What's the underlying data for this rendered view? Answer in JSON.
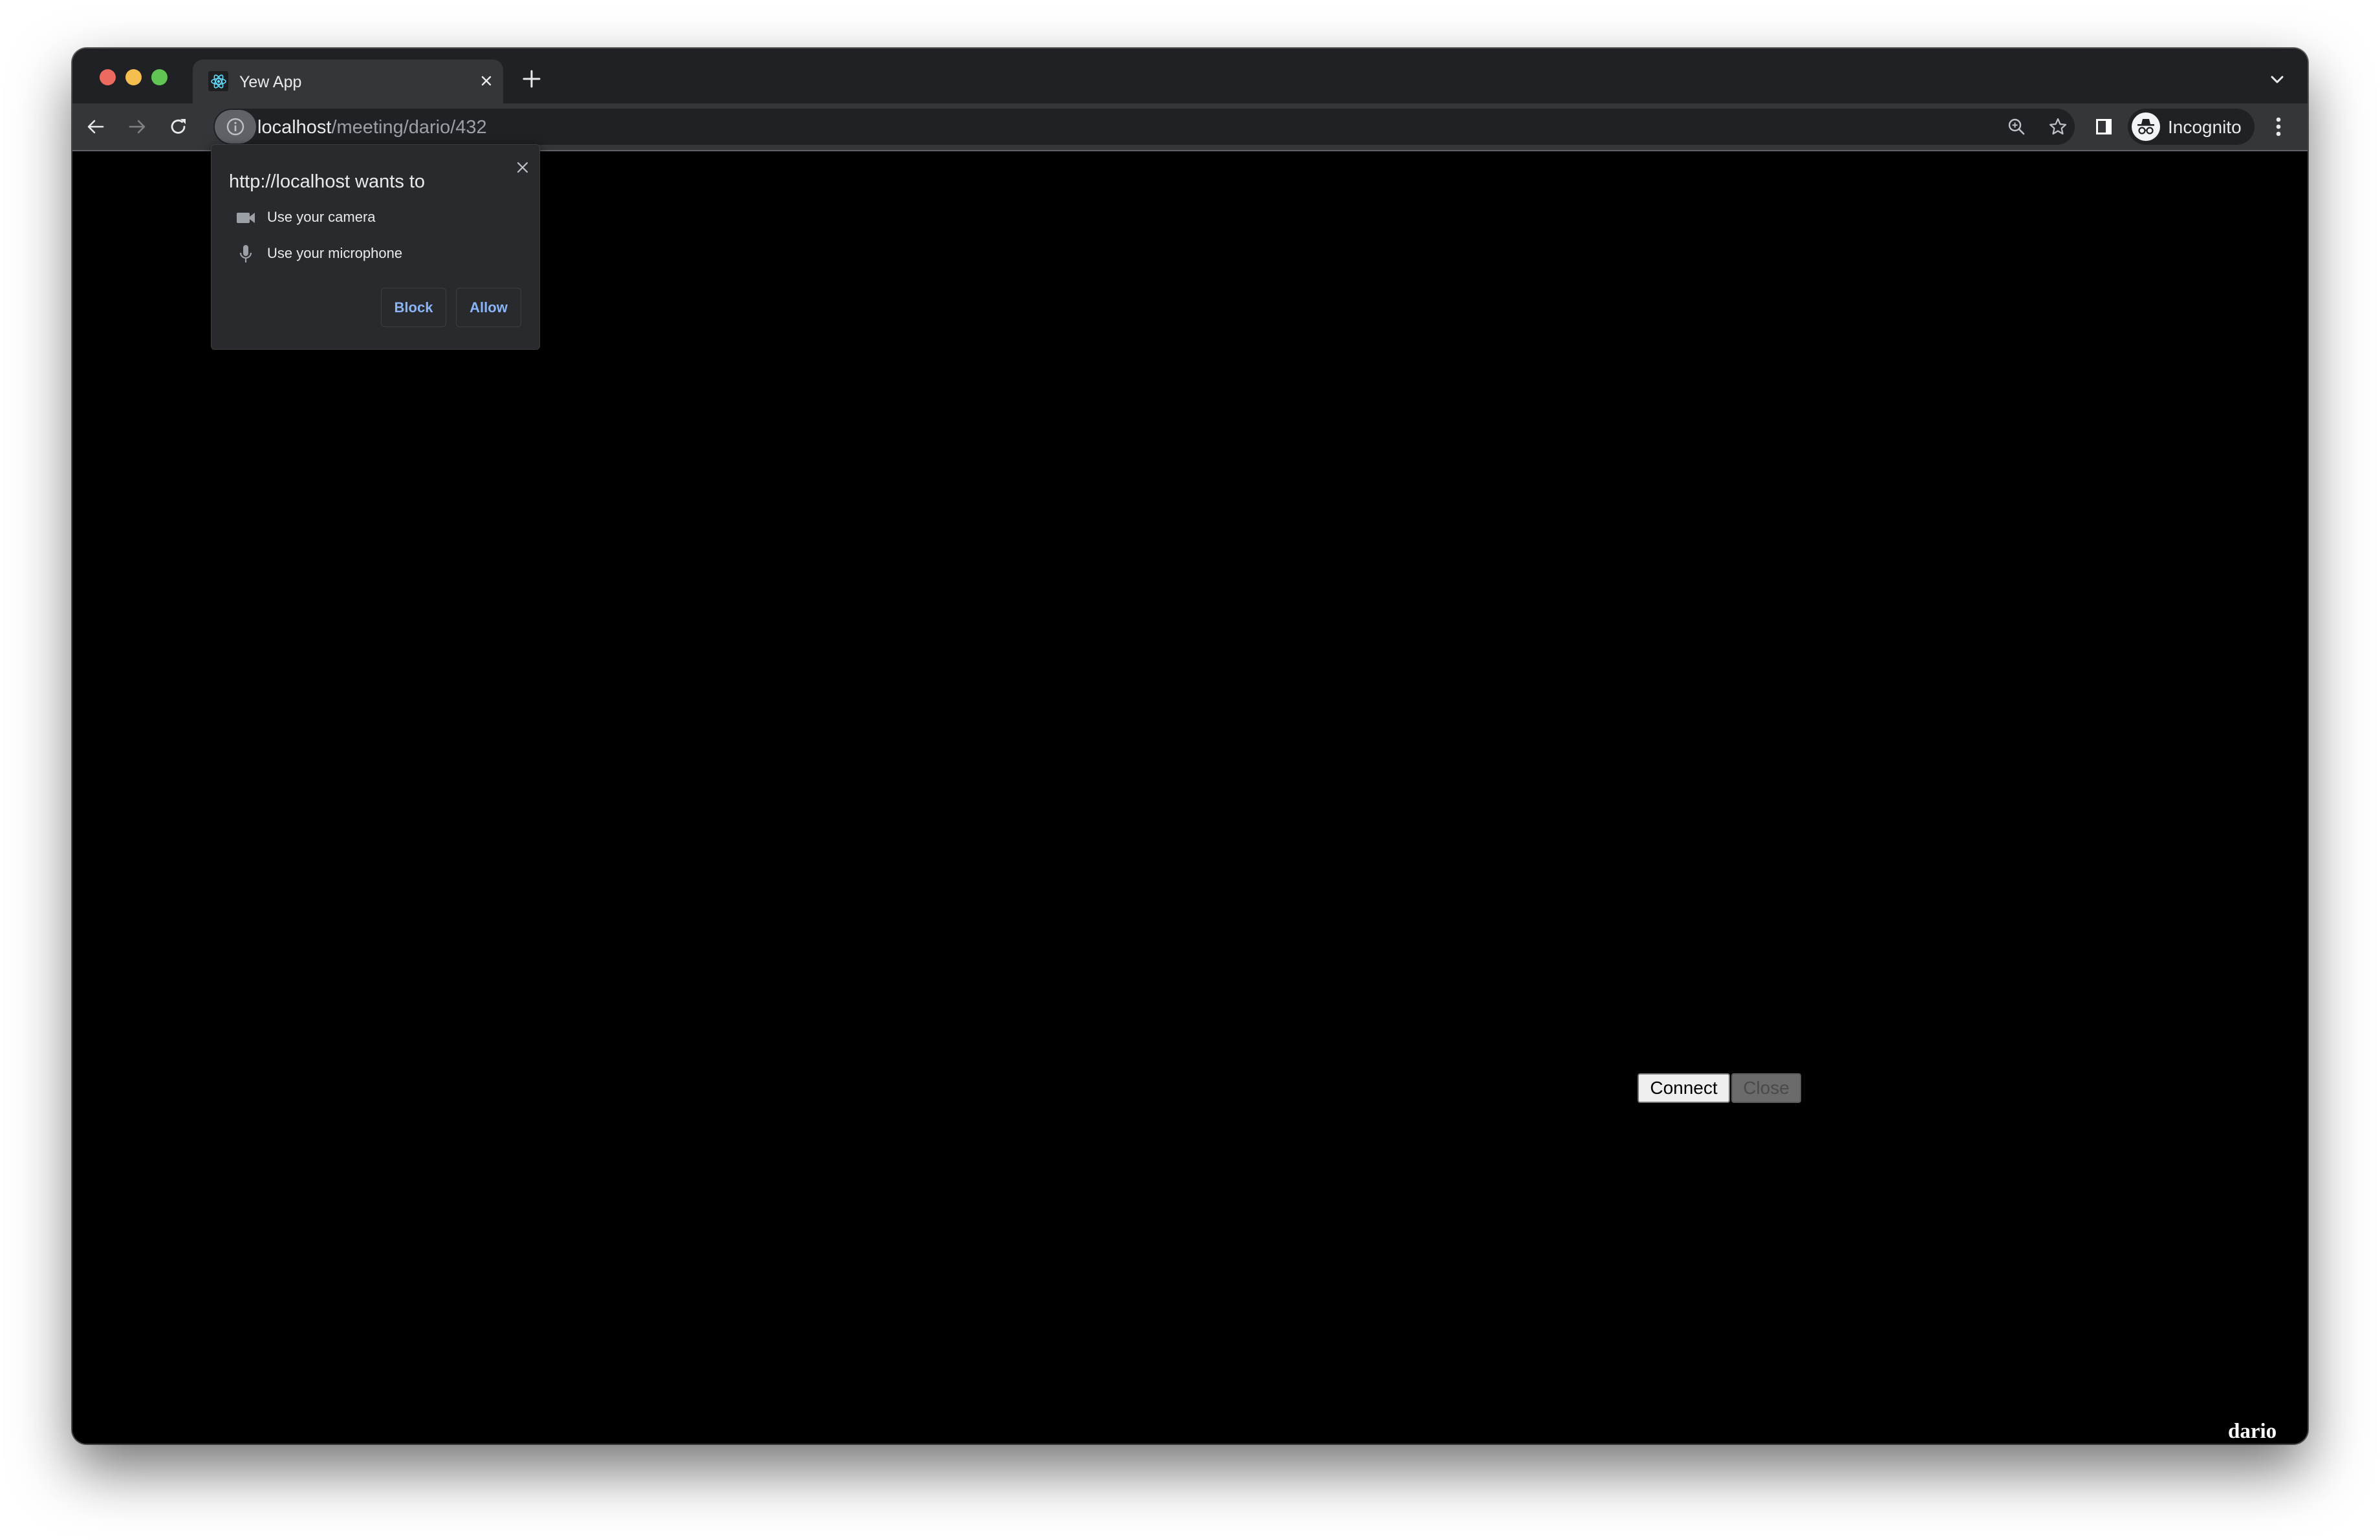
{
  "browser": {
    "tab": {
      "title": "Yew App",
      "favicon": "react-atom-icon",
      "close_icon": "close-icon"
    },
    "new_tab_icon": "plus-icon",
    "tab_search_icon": "chevron-down-icon",
    "nav": {
      "back_icon": "arrow-left-icon",
      "forward_icon": "arrow-right-icon",
      "reload_icon": "reload-icon"
    },
    "address_bar": {
      "info_icon": "info-icon",
      "host": "localhost",
      "path": "/meeting/dario/432",
      "zoom_icon": "zoom-in-icon",
      "bookmark_icon": "star-icon"
    },
    "side_panel_icon": "side-panel-icon",
    "profile": {
      "label": "Incognito",
      "icon": "incognito-icon"
    },
    "menu_icon": "kebab-menu-icon"
  },
  "permission_prompt": {
    "title": "http://localhost wants to",
    "items": [
      {
        "icon": "camera-icon",
        "label": "Use your camera"
      },
      {
        "icon": "microphone-icon",
        "label": "Use your microphone"
      }
    ],
    "block_label": "Block",
    "allow_label": "Allow"
  },
  "app": {
    "connect_label": "Connect",
    "close_label": "Close",
    "username": "dario"
  },
  "colors": {
    "tabstrip_bg": "#202124",
    "toolbar_bg": "#35363a",
    "popup_bg": "#292a2d",
    "link_blue": "#8ab4f8",
    "content_bg": "#000000"
  }
}
